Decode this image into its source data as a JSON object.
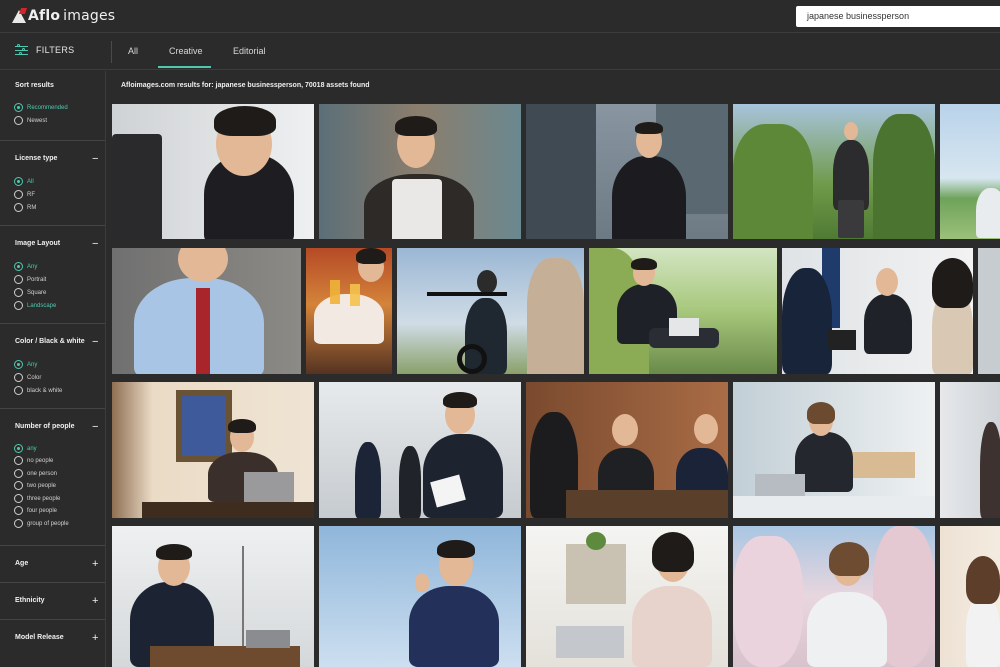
{
  "header": {
    "logo_text": "Aflo",
    "logo_text_2": "images",
    "search_value": "japanese businessperson"
  },
  "nav": {
    "filters_label": "FILTERS",
    "tabs": [
      {
        "label": "All"
      },
      {
        "label": "Creative"
      },
      {
        "label": "Editorial"
      }
    ],
    "active_tab": "Creative"
  },
  "results_text": "Afloimages.com results for: japanese businessperson, 70018 assets found",
  "sidebar": {
    "sort": {
      "title": "Sort results",
      "options": [
        "Recommended",
        "Newest"
      ]
    },
    "license": {
      "title": "License type",
      "toggle": "−",
      "options": [
        "All",
        "RF",
        "RM"
      ]
    },
    "layout": {
      "title": "Image Layout",
      "toggle": "−",
      "options": [
        "Any",
        "Portrait",
        "Square",
        "Landscape"
      ]
    },
    "color": {
      "title": "Color / Black & white",
      "toggle": "−",
      "options": [
        "Any",
        "Color",
        "black & white"
      ]
    },
    "people": {
      "title": "Number of people",
      "toggle": "−",
      "options": [
        "any",
        "no people",
        "one person",
        "two people",
        "three people",
        "four people",
        "group of people"
      ]
    },
    "age": {
      "title": "Age",
      "toggle": "+"
    },
    "ethnicity": {
      "title": "Ethnicity",
      "toggle": "+"
    },
    "model_release": {
      "title": "Model Release",
      "toggle": "+"
    }
  },
  "colors": {
    "background": "#2b2b2b",
    "accent": "#4ec9b0",
    "text": "#e6e6e6"
  }
}
